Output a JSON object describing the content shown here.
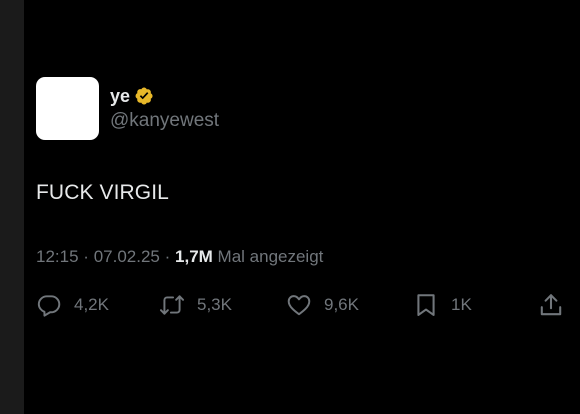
{
  "author": {
    "display_name": "ye",
    "handle": "@kanyewest",
    "verified": true,
    "verified_color": "#e8b829"
  },
  "tweet": {
    "text": "FUCK VIRGIL",
    "time": "12:15",
    "separator": "·",
    "date": "07.02.25",
    "views_count": "1,7M",
    "views_label": "Mal angezeigt"
  },
  "actions": {
    "reply": {
      "icon": "reply-icon",
      "count": "4,2K"
    },
    "retweet": {
      "icon": "retweet-icon",
      "count": "5,3K"
    },
    "like": {
      "icon": "heart-icon",
      "count": "9,6K"
    },
    "bookmark": {
      "icon": "bookmark-icon",
      "count": "1K"
    },
    "share": {
      "icon": "share-icon"
    }
  },
  "colors": {
    "background": "#000000",
    "text_primary": "#e7e9ea",
    "text_secondary": "#71767b",
    "avatar": "#ffffff"
  }
}
